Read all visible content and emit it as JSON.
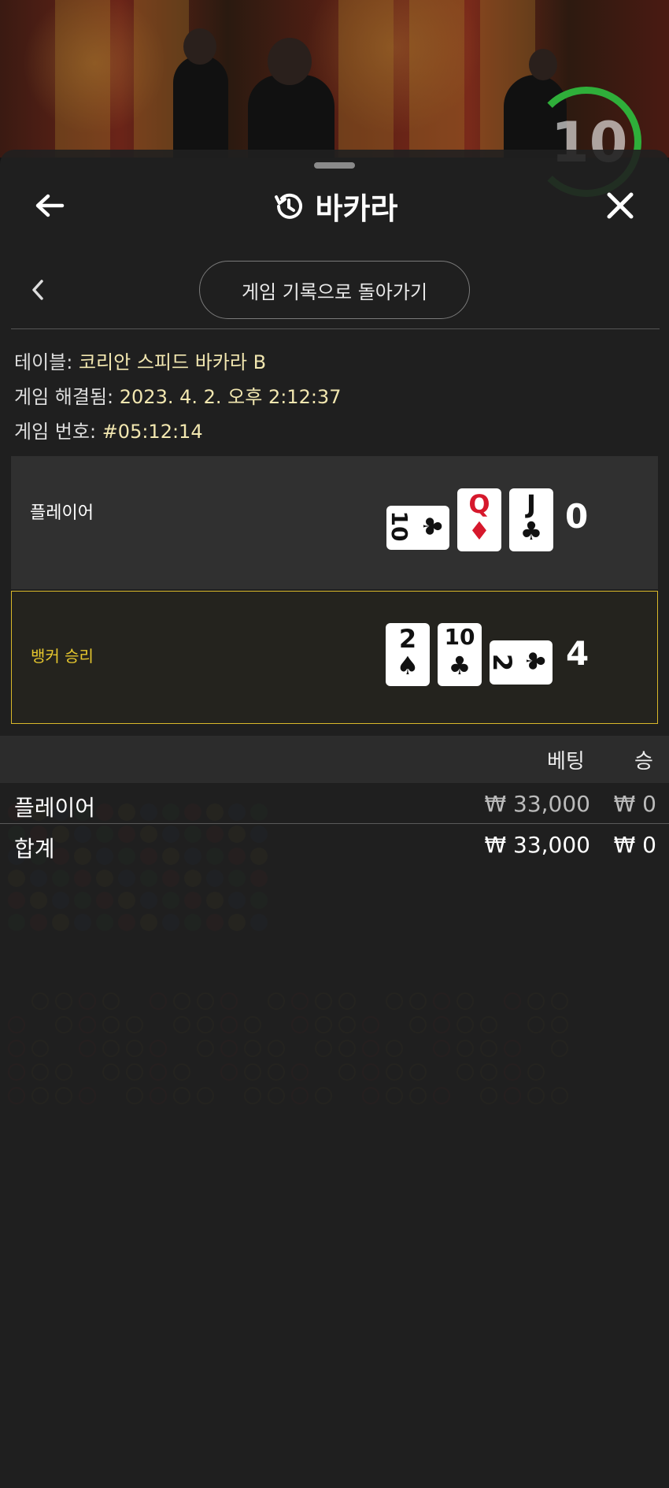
{
  "video": {
    "timer_value": "10"
  },
  "header": {
    "back_icon": "arrow-left-icon",
    "history_icon": "history-icon",
    "title": "바카라",
    "close_icon": "close-icon"
  },
  "nav": {
    "prev_icon": "chevron-left-icon",
    "back_to_history_label": "게임 기록으로 돌아가기"
  },
  "details": {
    "table_label": "테이블:",
    "table_value": "코리안 스피드 바카라 B",
    "resolved_label": "게임 해결됨:",
    "resolved_value": "2023. 4. 2. 오후 2:12:37",
    "number_label": "게임 번호:",
    "number_value": "#05:12:14"
  },
  "hands": [
    {
      "label": "플레이어",
      "score": "0",
      "cards": [
        {
          "rank": "10",
          "suit": "♣",
          "color": "#111111",
          "rotated": true
        },
        {
          "rank": "Q",
          "suit": "♦",
          "color": "#d6182c",
          "rotated": false
        },
        {
          "rank": "J",
          "suit": "♣",
          "color": "#111111",
          "rotated": false
        }
      ]
    },
    {
      "label": "뱅커 승리",
      "score": "4",
      "winner": true,
      "cards": [
        {
          "rank": "2",
          "suit": "♠",
          "color": "#111111",
          "rotated": false
        },
        {
          "rank": "10",
          "suit": "♣",
          "color": "#111111",
          "rotated": false
        },
        {
          "rank": "2",
          "suit": "♣",
          "color": "#111111",
          "rotated": true
        }
      ]
    }
  ],
  "bets_table": {
    "headers": {
      "bet": "베팅",
      "win": "승"
    },
    "rows": [
      {
        "name": "플레이어",
        "bet": "₩ 33,000",
        "win": "₩ 0"
      }
    ],
    "total": {
      "name": "합계",
      "bet": "₩ 33,000",
      "win": "₩ 0"
    }
  },
  "colors": {
    "accent_gold": "#d9b82a",
    "info_value": "#f2e7b0",
    "timer_green": "#2faf3a"
  }
}
